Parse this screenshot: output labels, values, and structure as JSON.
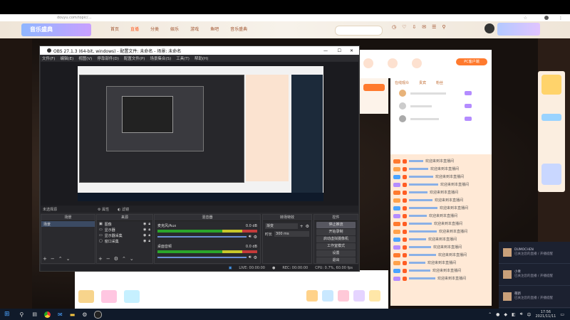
{
  "browser": {
    "url": "douyu.com/topic/...",
    "nav_items": [
      "首页",
      "直播",
      "分类",
      "娱乐",
      "游戏",
      "鱼吧",
      "音乐盛典"
    ],
    "logo_text": "音乐盛典",
    "right_icons": [
      "历史",
      "关注",
      "下载",
      "消息",
      "任务",
      "位置"
    ]
  },
  "obs": {
    "title": "OBS 27.1.3 (64-bit, windows) - 配置文件: 未命名 - 场景: 未命名",
    "menu": [
      "文件(F)",
      "编辑(E)",
      "视图(V)",
      "停靠部件(D)",
      "配置文件(P)",
      "场景集合(S)",
      "工具(T)",
      "帮助(H)"
    ],
    "no_source": "未选择源",
    "props_label": "属性",
    "filters_label": "滤镜",
    "docks": {
      "scenes": {
        "title": "场景",
        "items": [
          "场景"
        ]
      },
      "sources": {
        "title": "来源",
        "items": [
          "图像",
          "显示器",
          "显示器采集",
          "窗口采集"
        ]
      },
      "mixer": {
        "title": "混音器",
        "channels": [
          {
            "name": "麦克风/Aux",
            "db": "0.0 dB"
          },
          {
            "name": "桌面音频",
            "db": "0.0 dB"
          }
        ]
      },
      "transitions": {
        "title": "转场特效",
        "type": "渐变",
        "duration_label": "时长",
        "duration": "300 ms"
      },
      "controls": {
        "title": "控件",
        "buttons": [
          "停止推流",
          "开始录制",
          "启动虚拟摄像机",
          "工作室模式",
          "设置",
          "退出"
        ]
      }
    },
    "status": {
      "live": "LIVE: 00:00:00",
      "rec": "REC: 00:00:00",
      "cpu": "CPU: 0.7%, 60.00 fps"
    }
  },
  "side": {
    "top_tabs": [
      "关注",
      "排行",
      "贡献"
    ],
    "rank_tabs": [
      "在线观众",
      "贵宾",
      "粉丝"
    ],
    "pc_badge": "PC客户端",
    "chat": [
      "欢迎来到本直播间",
      "欢迎来到本直播间",
      "欢迎来到本直播间",
      "欢迎来到本直播间",
      "欢迎来到本直播间",
      "欢迎来到本直播间",
      "欢迎来到本直播间",
      "欢迎来到本直播间",
      "欢迎来到本直播间",
      "欢迎来到本直播间",
      "欢迎来到本直播间",
      "欢迎来到本直播间",
      "欢迎来到本直播间",
      "欢迎来到本直播间",
      "欢迎来到本直播间",
      "欢迎来到本直播间"
    ]
  },
  "notifications": [
    {
      "name": "DUMOCHEN",
      "text": "已关注您的直播 / 开播提醒"
    },
    {
      "name": "小青",
      "text": "已关注您的直播 / 开播提醒"
    },
    {
      "name": "萌新",
      "text": "已关注您的直播 / 开播提醒"
    }
  ],
  "taskbar": {
    "time": "17:56",
    "date": "2021/11/11",
    "lang": "中",
    "apps": [
      "search-icon",
      "task-view-icon",
      "chrome-icon",
      "mail-icon",
      "folder-icon",
      "settings-icon",
      "obs-icon"
    ]
  },
  "colors": {
    "accent": "#ff6a1a",
    "obs_bg": "#2a2a2e",
    "chat_bg": "#ffe9d6",
    "brand": "#ff7a2e"
  }
}
